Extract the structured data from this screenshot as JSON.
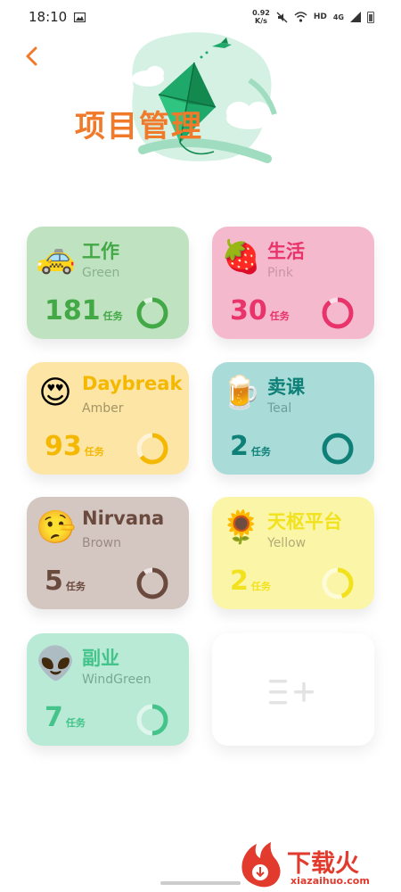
{
  "status_bar": {
    "time": "18:10",
    "net_speed_value": "0.92",
    "net_speed_unit": "K/s",
    "hd_label": "HD",
    "network_label": "4G"
  },
  "header": {
    "title": "项目管理"
  },
  "projects": [
    {
      "name": "工作",
      "theme": "Green",
      "count": "181",
      "unit": "任务",
      "icon": "taxi-emoji",
      "emoji": "🚕",
      "bg": "#bfe3c0",
      "accent": "#43a846",
      "sub_color": "#8ab18b",
      "progress": 0.9
    },
    {
      "name": "生活",
      "theme": "Pink",
      "count": "30",
      "unit": "任务",
      "icon": "strawberry-emoji",
      "emoji": "🍓",
      "bg": "#f5b9cd",
      "accent": "#e8336b",
      "sub_color": "#c895a6",
      "progress": 0.9
    },
    {
      "name": "Daybreak",
      "theme": "Amber",
      "count": "93",
      "unit": "任务",
      "icon": "heart-eyes-emoji",
      "emoji": "😍",
      "bg": "#fde5a6",
      "accent": "#f5b800",
      "sub_color": "#a39464",
      "progress": 0.65
    },
    {
      "name": "卖课",
      "theme": "Teal",
      "count": "2",
      "unit": "任务",
      "icon": "beer-mug-emoji",
      "emoji": "🍺",
      "bg": "#a9dcd8",
      "accent": "#0f8078",
      "sub_color": "#6f9e9a",
      "progress": 1.0
    },
    {
      "name": "Nirvana",
      "theme": "Brown",
      "count": "5",
      "unit": "任务",
      "icon": "lying-face-emoji",
      "emoji": "🤥",
      "bg": "#d4c6c1",
      "accent": "#6b4a3e",
      "sub_color": "#9a8a85",
      "progress": 0.9
    },
    {
      "name": "天枢平台",
      "theme": "Yellow",
      "count": "2",
      "unit": "任务",
      "icon": "sunflower-emoji",
      "emoji": "🌻",
      "bg": "#fbf5a8",
      "accent": "#f2e21e",
      "sub_color": "#b2ac78",
      "progress": 0.45
    },
    {
      "name": "副业",
      "theme": "WindGreen",
      "count": "7",
      "unit": "任务",
      "icon": "alien-emoji",
      "emoji": "👽",
      "bg": "#b8ead6",
      "accent": "#44c48a",
      "sub_color": "#77a994",
      "progress": 0.5
    }
  ],
  "add_card": {
    "icon": "add-list-icon"
  },
  "watermark": {
    "brand": "下载火",
    "url": "xiazaihuo.com"
  }
}
